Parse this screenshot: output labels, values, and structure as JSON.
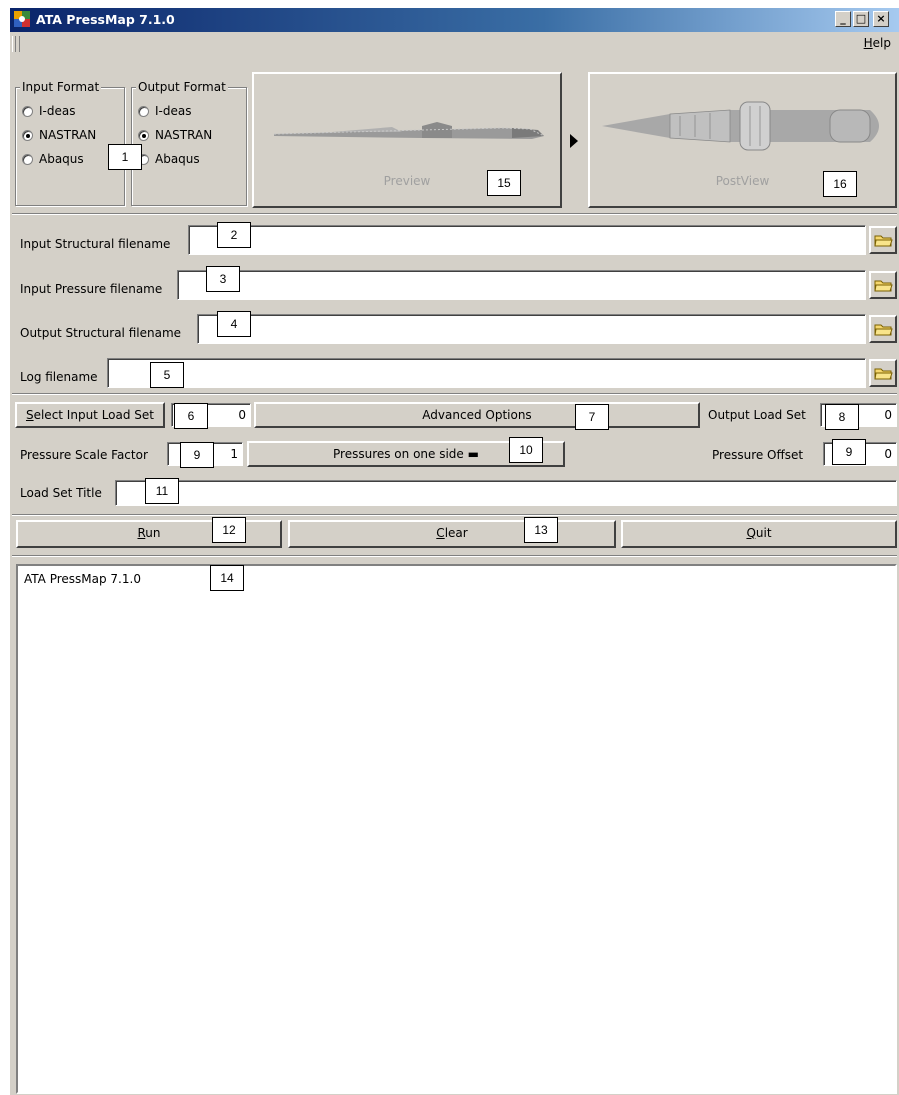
{
  "window": {
    "title": "ATA PressMap 7.1.0"
  },
  "menu": {
    "help_prefix": "",
    "help_mnemonic": "H",
    "help_rest": "elp"
  },
  "input_format": {
    "legend": "Input Format",
    "options": [
      "I-deas",
      "NASTRAN",
      "Abaqus"
    ],
    "selected": "NASTRAN"
  },
  "output_format": {
    "legend": "Output Format",
    "options": [
      "I-deas",
      "NASTRAN",
      "Abaqus"
    ],
    "selected": "NASTRAN"
  },
  "preview": {
    "label": "Preview"
  },
  "postview": {
    "label": "PostView"
  },
  "files": {
    "input_structural_label": "Input Structural filename",
    "input_structural_value": "",
    "input_pressure_label": "Input Pressure filename",
    "input_pressure_value": "",
    "output_structural_label": "Output Structural filename",
    "output_structural_value": "",
    "log_label": "Log filename",
    "log_value": ""
  },
  "loadset": {
    "select_label_mnemonic": "S",
    "select_label_rest": "elect Input Load Set",
    "select_value": "0",
    "advanced_label": "Advanced Options",
    "output_label": "Output Load Set",
    "output_value": "0"
  },
  "pressure": {
    "scale_label": "Pressure Scale Factor",
    "scale_value": "1",
    "side_label": "Pressures on one side",
    "offset_label": "Pressure Offset",
    "offset_value": "0"
  },
  "title_field": {
    "label": "Load Set Title",
    "value": ""
  },
  "actions": {
    "run_mnemonic": "R",
    "run_rest": "un",
    "clear_mnemonic": "C",
    "clear_rest": "lear",
    "quit_mnemonic": "Q",
    "quit_rest": "uit"
  },
  "log": {
    "text": "ATA PressMap 7.1.0"
  },
  "callouts": {
    "c1": "1",
    "c2": "2",
    "c3": "3",
    "c4": "4",
    "c5": "5",
    "c6": "6",
    "c7": "7",
    "c8": "8",
    "c9a": "9",
    "c9b": "9",
    "c10": "10",
    "c11": "11",
    "c12": "12",
    "c13": "13",
    "c14": "14",
    "c15": "15",
    "c16": "16"
  },
  "icons": {
    "app": "app-logo-icon",
    "minimize": "minimize-icon",
    "maximize": "maximize-icon",
    "close": "close-icon",
    "folder": "folder-open-icon",
    "arrow": "play-arrow-icon"
  }
}
